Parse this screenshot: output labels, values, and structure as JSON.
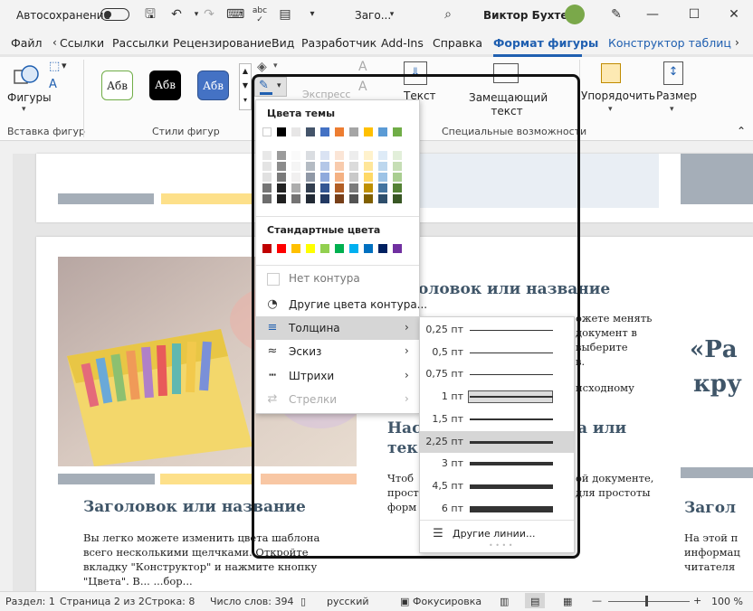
{
  "titlebar": {
    "autosave_label": "Автосохранение",
    "doc_title": "Заго...",
    "user_name": "Виктор Бухтеев",
    "abc_label": "abc"
  },
  "tabs": [
    "Файл",
    "Ссылки",
    "Рассылки",
    "Рецензирование",
    "Вид",
    "Разработчик",
    "Add-Ins",
    "Справка",
    "Формат фигуры",
    "Конструктор таблиц"
  ],
  "ribbon": {
    "shapes_label": "Фигуры",
    "insert_shapes_group": "Вставка фигур",
    "styles_group": "Стили фигур",
    "style_sample": "Абв",
    "express_label": "Экспресс",
    "text_label": "Текст",
    "alt_text_label": "Замещающий текст",
    "accessibility_group": "Специальные возможности",
    "arrange_label": "Упорядочить",
    "size_label": "Размер"
  },
  "outline_menu": {
    "theme_colors_title": "Цвета темы",
    "standard_colors_title": "Стандартные цвета",
    "no_outline": "Нет контура",
    "more_colors": "Другие цвета контура...",
    "weight": "Толщина",
    "sketch": "Эскиз",
    "dashes": "Штрихи",
    "arrows": "Стрелки"
  },
  "theme_colors": [
    "#ffffff",
    "#000000",
    "#e7e6e6",
    "#44546a",
    "#4472c4",
    "#ed7d31",
    "#a5a5a5",
    "#ffc000",
    "#5b9bd5",
    "#70ad47"
  ],
  "standard_colors": [
    "#c00000",
    "#ff0000",
    "#ffc000",
    "#ffff00",
    "#92d050",
    "#00b050",
    "#00b0f0",
    "#0070c0",
    "#002060",
    "#7030a0"
  ],
  "weights": [
    {
      "label": "0,25 пт",
      "thickness": 1,
      "selected": false
    },
    {
      "label": "0,5 пт",
      "thickness": 1,
      "selected": false
    },
    {
      "label": "0,75 пт",
      "thickness": 1,
      "selected": false
    },
    {
      "label": "1 пт",
      "thickness": 2,
      "selected": false
    },
    {
      "label": "1,5 пт",
      "thickness": 2,
      "selected": false
    },
    {
      "label": "2,25 пт",
      "thickness": 3,
      "selected": true
    },
    {
      "label": "3 пт",
      "thickness": 4,
      "selected": false
    },
    {
      "label": "4,5 пт",
      "thickness": 5,
      "selected": false
    },
    {
      "label": "6 пт",
      "thickness": 7,
      "selected": false
    }
  ],
  "more_lines": "Другие линии...",
  "document": {
    "heading1": "Заголовок или название",
    "heading_partial": "оловок или название",
    "heading2a": "Нас",
    "heading2b": "а или",
    "heading2c": "тек",
    "quote_a": "«Ра",
    "quote_b": "кру",
    "heading3": "Загол",
    "col1_lines": [
      "Вы легко можете изменить цвета шаблона",
      "всего несколькими щелчками. Откройте",
      "вкладку \"Конструктор\" и нажмите кнопку",
      "\"Цвета\". В...           ...бор..."
    ],
    "col2_right": [
      "ожете менять",
      "документ в",
      "выберите",
      "в.",
      "исходному"
    ],
    "col2_lower_left": [
      "Чтоб",
      "прост",
      "форм"
    ],
    "col2_lower_right": [
      "ой документе,",
      "для простоты"
    ],
    "col3_lines": [
      "На этой п",
      "информац",
      "читателя"
    ]
  },
  "statusbar": {
    "section": "Раздел: 1",
    "page": "Страница 2 из 2",
    "line": "Строка: 8",
    "words": "Число слов: 394",
    "language": "русский",
    "focus": "Фокусировка",
    "zoom": "100 %"
  },
  "accent_color": "#1f5fb0"
}
